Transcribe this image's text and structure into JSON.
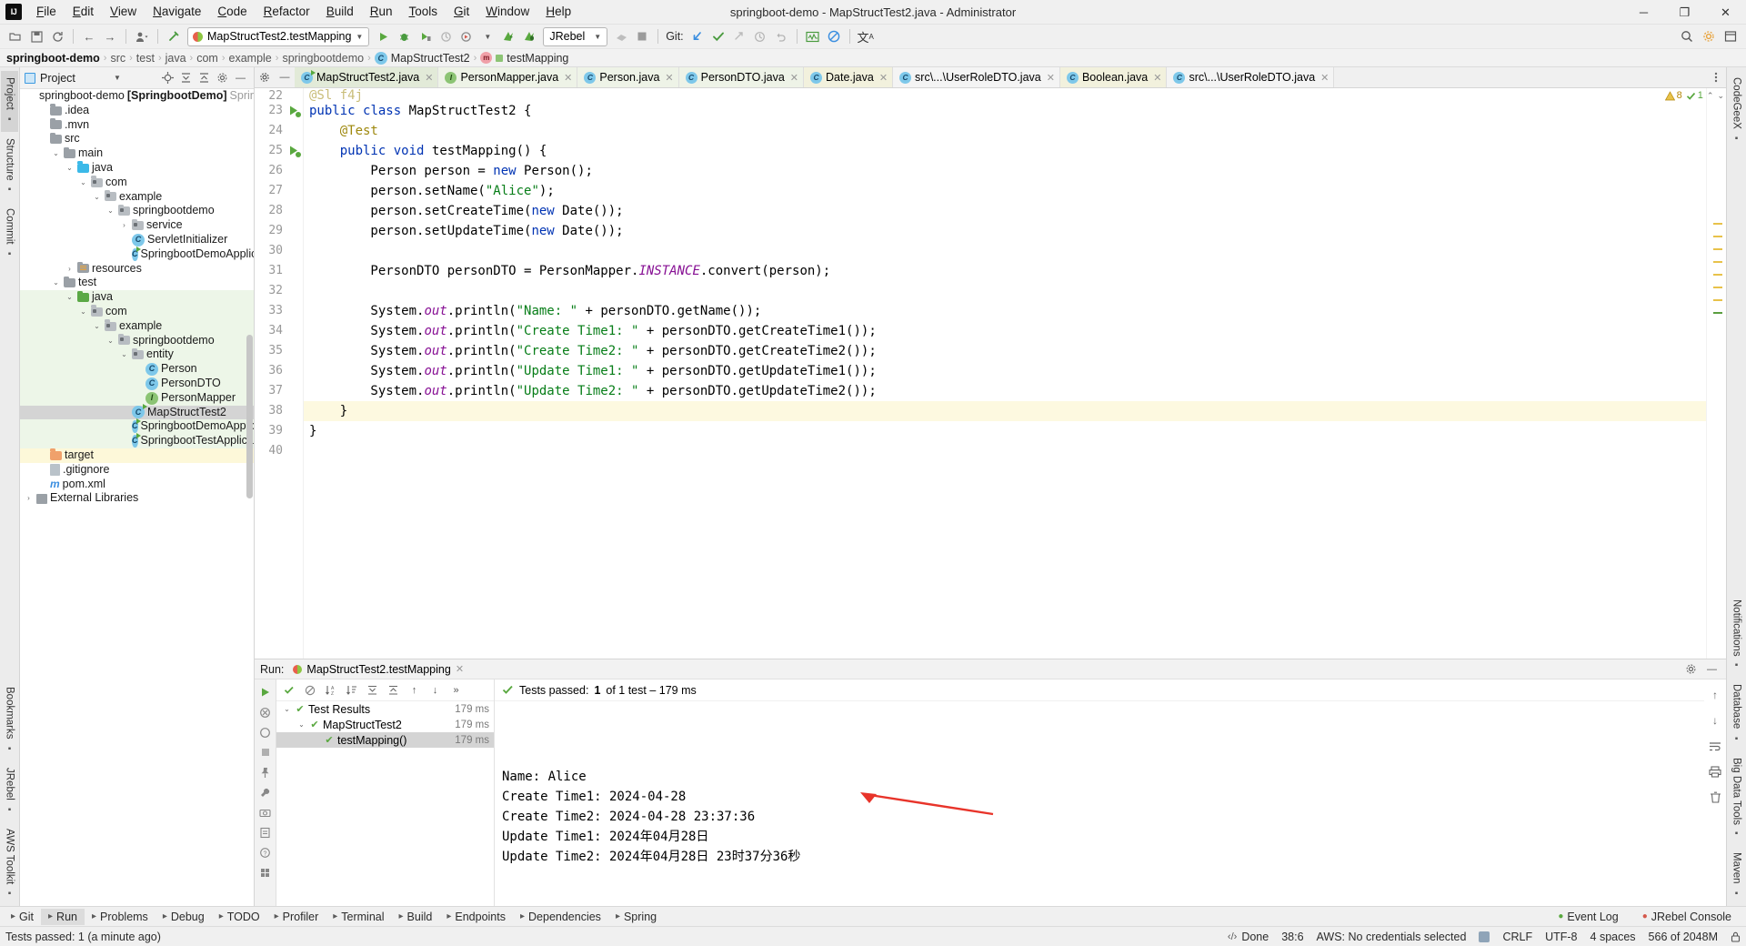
{
  "window": {
    "title": "springboot-demo - MapStructTest2.java - Administrator",
    "logo": "intellij-idea-logo",
    "minimize": "─",
    "maximize": "❐",
    "close": "✕"
  },
  "menubar": [
    {
      "label": "File"
    },
    {
      "label": "Edit"
    },
    {
      "label": "View"
    },
    {
      "label": "Navigate"
    },
    {
      "label": "Code"
    },
    {
      "label": "Refactor"
    },
    {
      "label": "Build"
    },
    {
      "label": "Run"
    },
    {
      "label": "Tools"
    },
    {
      "label": "Git"
    },
    {
      "label": "Window"
    },
    {
      "label": "Help"
    }
  ],
  "toolbar": {
    "run_config": "MapStructTest2.testMapping",
    "jrebel_label": "JRebel",
    "git_label": "Git:",
    "icons": [
      "open-folder-icon",
      "save-icon",
      "sync-icon",
      "back-arrow-icon",
      "forward-arrow-icon",
      "profile-icon",
      "build-hammer-icon",
      "run-icon",
      "debug-icon",
      "run-coverage-icon",
      "profiler-icon",
      "rerun-icon",
      "jrebel-run-icon",
      "jrebel-debug-icon",
      "stop-icon",
      "update-project-icon",
      "commit-icon",
      "push-icon",
      "history-icon",
      "rollback-icon",
      "monitor-icon",
      "no-entry-icon",
      "translate-icon",
      "search-everywhere-icon",
      "settings-gear-icon",
      "minimize-window-icon"
    ]
  },
  "breadcrumb": [
    {
      "label": "springboot-demo",
      "style": "root"
    },
    {
      "label": "src",
      "style": "dim"
    },
    {
      "label": "test",
      "style": "dim"
    },
    {
      "label": "java",
      "style": "dim"
    },
    {
      "label": "com",
      "style": "dim"
    },
    {
      "label": "example",
      "style": "dim"
    },
    {
      "label": "springbootdemo",
      "style": "dim"
    },
    {
      "label": "MapStructTest2",
      "icon": "class-icon",
      "style": "normal"
    },
    {
      "label": "testMapping",
      "icon": "method-test-icon",
      "style": "normal"
    }
  ],
  "left_rail": [
    {
      "label": "Project",
      "icon": "project-icon",
      "active": true
    },
    {
      "label": "Structure",
      "icon": "structure-icon",
      "active": false
    },
    {
      "label": "Commit",
      "icon": "commit-icon",
      "active": false
    },
    {
      "label": "Bookmarks",
      "icon": "bookmarks-icon",
      "active": false
    },
    {
      "label": "JRebel",
      "icon": "jrebel-icon",
      "active": false
    },
    {
      "label": "AWS Toolkit",
      "icon": "aws-icon",
      "active": false
    }
  ],
  "right_rail": [
    {
      "label": "CodeGeeX",
      "icon": "codegeex-icon"
    },
    {
      "label": "Notifications",
      "icon": "bell-icon"
    },
    {
      "label": "Database",
      "icon": "database-icon"
    },
    {
      "label": "Big Data Tools",
      "icon": "bigdata-icon"
    },
    {
      "label": "Maven",
      "icon": "maven-icon"
    }
  ],
  "project_panel": {
    "title": "Project",
    "tools": [
      "locate-icon",
      "expand-all-icon",
      "collapse-all-icon",
      "settings-icon",
      "hide-icon"
    ],
    "tree": [
      {
        "depth": 0,
        "arrow": "none",
        "icon": "module-icon",
        "label": "springboot-demo",
        "suffix": "[SpringbootDemo]",
        "suffix2": "SpringbootDe",
        "bold_suffix": true
      },
      {
        "depth": 1,
        "arrow": "none",
        "icon": "folder-gray",
        "label": ".idea"
      },
      {
        "depth": 1,
        "arrow": "none",
        "icon": "folder-gray",
        "label": ".mvn"
      },
      {
        "depth": 1,
        "arrow": "none",
        "icon": "folder-gray",
        "label": "src"
      },
      {
        "depth": 2,
        "arrow": "down",
        "icon": "folder-gray",
        "label": "main"
      },
      {
        "depth": 3,
        "arrow": "down",
        "icon": "folder-blue",
        "label": "java"
      },
      {
        "depth": 4,
        "arrow": "down",
        "icon": "folder-pkg",
        "label": "com"
      },
      {
        "depth": 5,
        "arrow": "down",
        "icon": "folder-pkg",
        "label": "example"
      },
      {
        "depth": 6,
        "arrow": "down",
        "icon": "folder-pkg",
        "label": "springbootdemo"
      },
      {
        "depth": 7,
        "arrow": "right",
        "icon": "folder-pkg",
        "label": "service"
      },
      {
        "depth": 7,
        "arrow": "none",
        "icon": "class-icon",
        "label": "ServletInitializer"
      },
      {
        "depth": 7,
        "arrow": "none",
        "icon": "class-run-icon",
        "label": "SpringbootDemoApplication"
      },
      {
        "depth": 3,
        "arrow": "right",
        "icon": "folder-res",
        "label": "resources"
      },
      {
        "depth": 2,
        "arrow": "down",
        "icon": "folder-gray",
        "label": "test"
      },
      {
        "depth": 3,
        "arrow": "down",
        "icon": "folder-green",
        "label": "java",
        "scope": "test"
      },
      {
        "depth": 4,
        "arrow": "down",
        "icon": "folder-pkg",
        "label": "com",
        "scope": "test"
      },
      {
        "depth": 5,
        "arrow": "down",
        "icon": "folder-pkg",
        "label": "example",
        "scope": "test"
      },
      {
        "depth": 6,
        "arrow": "down",
        "icon": "folder-pkg",
        "label": "springbootdemo",
        "scope": "test"
      },
      {
        "depth": 7,
        "arrow": "down",
        "icon": "folder-pkg",
        "label": "entity",
        "scope": "test"
      },
      {
        "depth": 8,
        "arrow": "none",
        "icon": "class-icon",
        "label": "Person",
        "scope": "test"
      },
      {
        "depth": 8,
        "arrow": "none",
        "icon": "class-icon",
        "label": "PersonDTO",
        "scope": "test"
      },
      {
        "depth": 8,
        "arrow": "none",
        "icon": "interface-icon",
        "label": "PersonMapper",
        "scope": "test"
      },
      {
        "depth": 7,
        "arrow": "none",
        "icon": "class-run-icon",
        "label": "MapStructTest2",
        "selected": true
      },
      {
        "depth": 7,
        "arrow": "none",
        "icon": "class-run-icon",
        "label": "SpringbootDemoApplicationTes",
        "scope": "test"
      },
      {
        "depth": 7,
        "arrow": "none",
        "icon": "class-run-icon",
        "label": "SpringbootTestApplicationTests",
        "scope": "test"
      },
      {
        "depth": 1,
        "arrow": "none",
        "icon": "folder-orange",
        "label": "target",
        "highlight": true
      },
      {
        "depth": 1,
        "arrow": "none",
        "icon": "gitignore-icon",
        "label": ".gitignore"
      },
      {
        "depth": 1,
        "arrow": "none",
        "icon": "maven-xml-icon",
        "label": "pom.xml"
      },
      {
        "depth": 0,
        "arrow": "right",
        "icon": "library-icon",
        "label": "External Libraries"
      }
    ]
  },
  "editor_tabs": [
    {
      "label": "MapStructTest2.java",
      "icon": "class-run-icon",
      "active": true,
      "bg": "active"
    },
    {
      "label": "PersonMapper.java",
      "icon": "interface-icon",
      "bg": "green"
    },
    {
      "label": "Person.java",
      "icon": "class-icon",
      "bg": "green"
    },
    {
      "label": "PersonDTO.java",
      "icon": "class-icon",
      "bg": "green"
    },
    {
      "label": "Date.java",
      "icon": "class-icon",
      "bg": "yellow"
    },
    {
      "label": "src\\...\\UserRoleDTO.java",
      "icon": "class-icon",
      "bg": "plain"
    },
    {
      "label": "Boolean.java",
      "icon": "class-icon",
      "bg": "yellow"
    },
    {
      "label": "src\\...\\UserRoleDTO.java",
      "icon": "class-icon",
      "bg": "plain"
    }
  ],
  "inspection": {
    "warnings": "8",
    "oks": "1",
    "warn_icon": "warning-triangle-icon",
    "ok_icon": "checkmark-icon"
  },
  "editor": {
    "first_partial_line": "22",
    "partial_text": "@Sl f4j",
    "lines": [
      {
        "n": "23",
        "gutter_icon": "run-class-icon",
        "tokens": [
          {
            "t": "public ",
            "c": "kw"
          },
          {
            "t": "class ",
            "c": "kw"
          },
          {
            "t": "MapStructTest2",
            "c": "cls-name"
          },
          {
            "t": " {",
            "c": ""
          }
        ]
      },
      {
        "n": "24",
        "tokens": [
          {
            "t": "    ",
            "c": ""
          },
          {
            "t": "@Test",
            "c": "an"
          }
        ]
      },
      {
        "n": "25",
        "gutter_icon": "run-method-icon",
        "tokens": [
          {
            "t": "    ",
            "c": ""
          },
          {
            "t": "public ",
            "c": "kw"
          },
          {
            "t": "void ",
            "c": "kw"
          },
          {
            "t": "testMapping",
            "c": ""
          },
          {
            "t": "() {",
            "c": ""
          }
        ]
      },
      {
        "n": "26",
        "tokens": [
          {
            "t": "        Person person = ",
            "c": ""
          },
          {
            "t": "new ",
            "c": "kw"
          },
          {
            "t": "Person();",
            "c": ""
          }
        ]
      },
      {
        "n": "27",
        "tokens": [
          {
            "t": "        person.setName(",
            "c": ""
          },
          {
            "t": "\"Alice\"",
            "c": "str"
          },
          {
            "t": ");",
            "c": ""
          }
        ]
      },
      {
        "n": "28",
        "tokens": [
          {
            "t": "        person.setCreateTime(",
            "c": ""
          },
          {
            "t": "new ",
            "c": "kw"
          },
          {
            "t": "Date());",
            "c": ""
          }
        ]
      },
      {
        "n": "29",
        "tokens": [
          {
            "t": "        person.setUpdateTime(",
            "c": ""
          },
          {
            "t": "new ",
            "c": "kw"
          },
          {
            "t": "Date());",
            "c": ""
          }
        ]
      },
      {
        "n": "30",
        "tokens": [
          {
            "t": "",
            "c": ""
          }
        ]
      },
      {
        "n": "31",
        "tokens": [
          {
            "t": "        PersonDTO personDTO = PersonMapper.",
            "c": ""
          },
          {
            "t": "INSTANCE",
            "c": "stat"
          },
          {
            "t": ".convert(person);",
            "c": ""
          }
        ]
      },
      {
        "n": "32",
        "tokens": [
          {
            "t": "",
            "c": ""
          }
        ]
      },
      {
        "n": "33",
        "tokens": [
          {
            "t": "        System.",
            "c": ""
          },
          {
            "t": "out",
            "c": "stat"
          },
          {
            "t": ".println(",
            "c": ""
          },
          {
            "t": "\"Name: \"",
            "c": "str"
          },
          {
            "t": " + personDTO.getName());",
            "c": ""
          }
        ]
      },
      {
        "n": "34",
        "tokens": [
          {
            "t": "        System.",
            "c": ""
          },
          {
            "t": "out",
            "c": "stat"
          },
          {
            "t": ".println(",
            "c": ""
          },
          {
            "t": "\"Create Time1: \"",
            "c": "str"
          },
          {
            "t": " + personDTO.getCreateTime1());",
            "c": ""
          }
        ]
      },
      {
        "n": "35",
        "tokens": [
          {
            "t": "        System.",
            "c": ""
          },
          {
            "t": "out",
            "c": "stat"
          },
          {
            "t": ".println(",
            "c": ""
          },
          {
            "t": "\"Create Time2: \"",
            "c": "str"
          },
          {
            "t": " + personDTO.getCreateTime2());",
            "c": ""
          }
        ]
      },
      {
        "n": "36",
        "tokens": [
          {
            "t": "        System.",
            "c": ""
          },
          {
            "t": "out",
            "c": "stat"
          },
          {
            "t": ".println(",
            "c": ""
          },
          {
            "t": "\"Update Time1: \"",
            "c": "str"
          },
          {
            "t": " + personDTO.getUpdateTime1());",
            "c": ""
          }
        ]
      },
      {
        "n": "37",
        "tokens": [
          {
            "t": "        System.",
            "c": ""
          },
          {
            "t": "out",
            "c": "stat"
          },
          {
            "t": ".println(",
            "c": ""
          },
          {
            "t": "\"Update Time2: \"",
            "c": "str"
          },
          {
            "t": " + personDTO.getUpdateTime2());",
            "c": ""
          }
        ]
      },
      {
        "n": "38",
        "highlight": true,
        "tokens": [
          {
            "t": "    }",
            "c": ""
          }
        ]
      },
      {
        "n": "39",
        "tokens": [
          {
            "t": "}",
            "c": ""
          }
        ]
      },
      {
        "n": "40",
        "tokens": [
          {
            "t": "",
            "c": ""
          }
        ]
      }
    ]
  },
  "run_panel": {
    "label": "Run:",
    "tab": "MapStructTest2.testMapping",
    "status": {
      "prefix": "Tests passed: ",
      "count": "1",
      "suffix": " of 1 test – 179 ms"
    },
    "tools": [
      "rerun-icon",
      "rerun-failed-icon",
      "toggle-auto-test-icon",
      "filter-icon",
      "sort-alpha-icon",
      "sort-duration-icon",
      "expand-all-icon",
      "collapse-all-icon",
      "prev-test-icon",
      "next-test-icon",
      "more-icon"
    ],
    "tests": [
      {
        "depth": 0,
        "arrow": "down",
        "label": "Test Results",
        "time": "179 ms"
      },
      {
        "depth": 1,
        "arrow": "down",
        "label": "MapStructTest2",
        "time": "179 ms"
      },
      {
        "depth": 2,
        "arrow": "none",
        "label": "testMapping()",
        "time": "179 ms",
        "selected": true
      }
    ],
    "console_lines": [
      "Name: Alice",
      "Create Time1: 2024-04-28",
      "Create Time2: 2024-04-28 23:37:36",
      "Update Time1: 2024年04月28日",
      "Update Time2: 2024年04月28日 23时37分36秒"
    ],
    "side_tools": [
      "scroll-up-icon",
      "scroll-down-icon",
      "soft-wrap-icon",
      "print-icon",
      "trash-icon"
    ],
    "header_tools": [
      "settings-gear-icon",
      "hide-icon"
    ]
  },
  "tool_strip": [
    {
      "label": "Git",
      "icon": "git-branch-icon"
    },
    {
      "label": "Run",
      "icon": "run-icon",
      "active": true
    },
    {
      "label": "Problems",
      "icon": "problems-icon"
    },
    {
      "label": "Debug",
      "icon": "debug-icon"
    },
    {
      "label": "TODO",
      "icon": "todo-icon"
    },
    {
      "label": "Profiler",
      "icon": "profiler-icon"
    },
    {
      "label": "Terminal",
      "icon": "terminal-icon"
    },
    {
      "label": "Build",
      "icon": "build-icon"
    },
    {
      "label": "Endpoints",
      "icon": "endpoints-icon"
    },
    {
      "label": "Dependencies",
      "icon": "dependencies-icon"
    },
    {
      "label": "Spring",
      "icon": "spring-icon"
    }
  ],
  "tool_strip_right": [
    {
      "label": "Event Log",
      "icon": "event-log-icon"
    },
    {
      "label": "JRebel Console",
      "icon": "jrebel-icon"
    }
  ],
  "statusbar": {
    "left": "Tests passed: 1 (a minute ago)",
    "items": [
      {
        "label": "Done",
        "icon": "terminal-chevron-icon"
      },
      {
        "label": "38:6"
      },
      {
        "label": "AWS: No credentials selected"
      },
      {
        "label": "",
        "icon": "aws-status-icon"
      },
      {
        "label": "CRLF"
      },
      {
        "label": "UTF-8"
      },
      {
        "label": "4 spaces"
      },
      {
        "label": "566 of 2048M"
      },
      {
        "label": "",
        "icon": "lock-icon"
      }
    ]
  }
}
